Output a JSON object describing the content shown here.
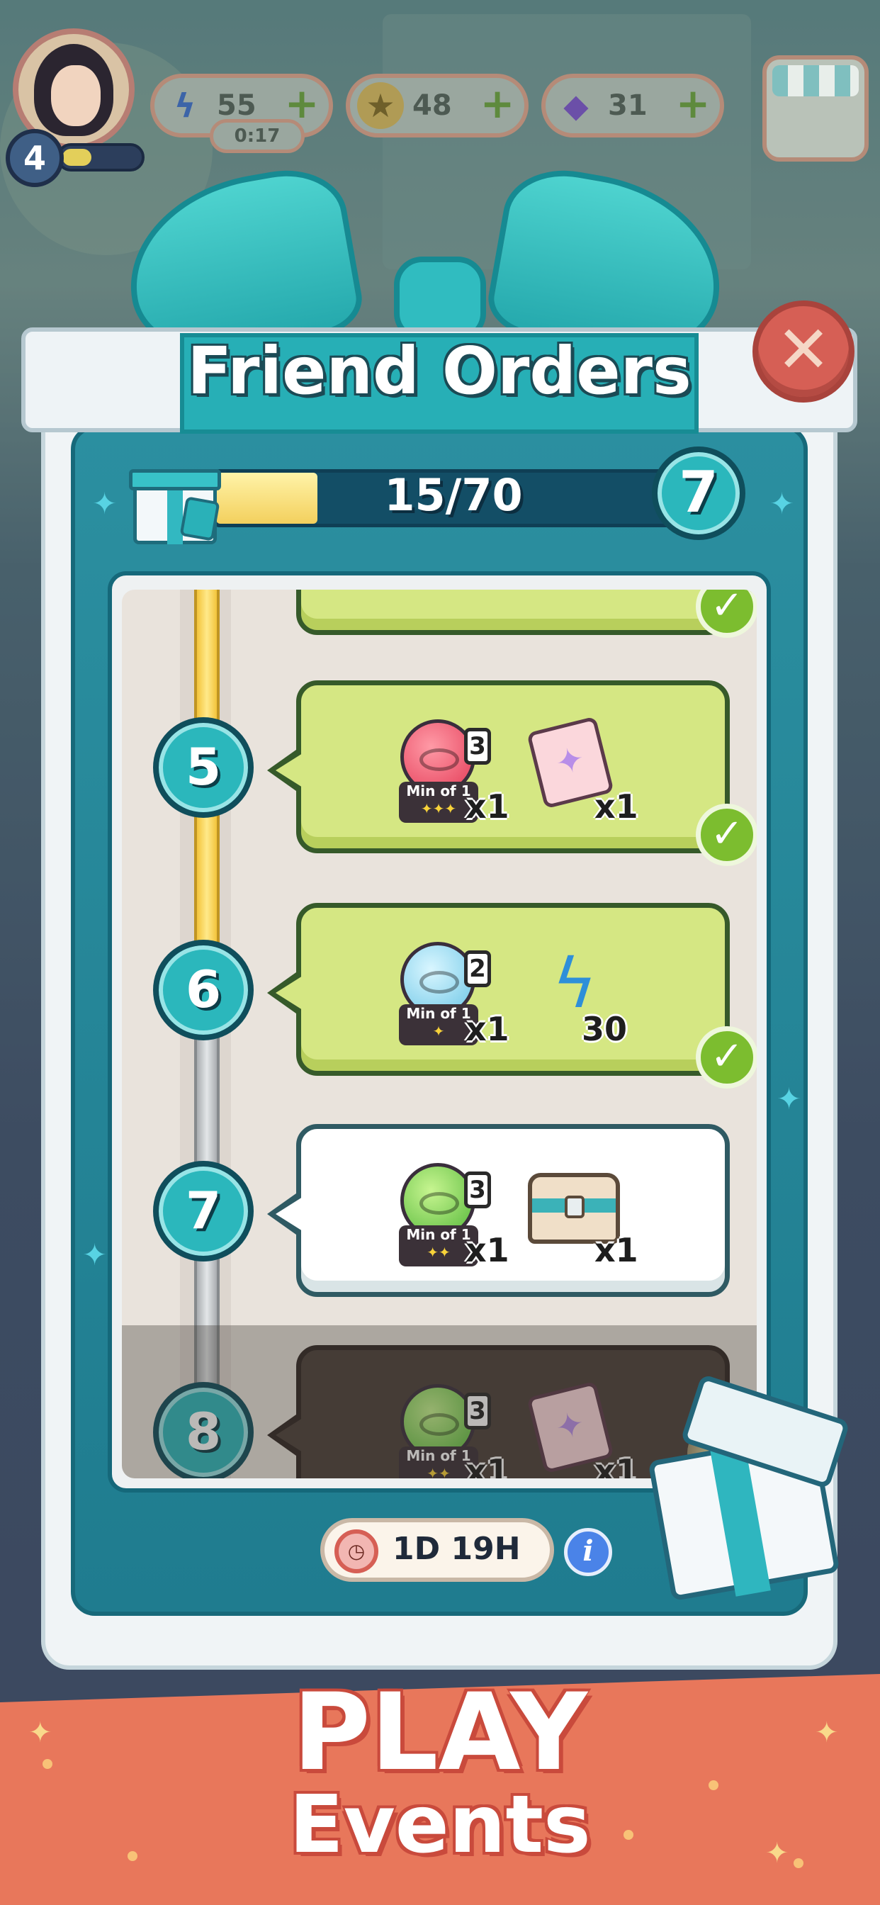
{
  "hud": {
    "level": "4",
    "xp_progress": 0.35,
    "energy": {
      "icon": "lightning-icon",
      "value": "55",
      "timer": "0:17"
    },
    "coins": {
      "icon": "coin-icon",
      "value": "48"
    },
    "gems": {
      "icon": "gem-icon",
      "value": "31"
    },
    "plus_symbol": "+"
  },
  "popup": {
    "title": "Friend Orders",
    "close_symbol": "✕",
    "progress": {
      "text": "15/70",
      "fraction": 0.214,
      "level": "7"
    },
    "orders": [
      {
        "step": "5",
        "state": "completed",
        "orb_color": "red",
        "orb_tier": "3",
        "min_label": "Min of 1",
        "stars": "✦✦✦",
        "orb_qty": "x1",
        "reward": "ticket-icon",
        "reward_qty": "x1"
      },
      {
        "step": "6",
        "state": "completed",
        "orb_color": "blue",
        "orb_tier": "2",
        "min_label": "Min of 1",
        "stars": "✦",
        "orb_qty": "x1",
        "reward": "energy-bolt-icon",
        "reward_qty": "30"
      },
      {
        "step": "7",
        "state": "active",
        "orb_color": "green",
        "orb_tier": "3",
        "min_label": "Min of 1",
        "stars": "✦✦",
        "orb_qty": "x1",
        "reward": "chest-icon",
        "reward_qty": "x1"
      },
      {
        "step": "8",
        "state": "locked",
        "orb_color": "green",
        "orb_tier": "3",
        "min_label": "Min of 1",
        "stars": "✦✦",
        "orb_qty": "x1",
        "reward": "ticket-icon",
        "reward_qty": "x1"
      }
    ],
    "timer": "1D 19H",
    "info_symbol": "i",
    "check_symbol": "✓"
  },
  "banner": {
    "title": "PLAY",
    "subtitle": "Events"
  },
  "colors": {
    "teal": "#2bb7bc",
    "completed_bubble": "#d5e783",
    "check_green": "#7cbd2f",
    "close_red": "#d65f55",
    "banner_orange": "#e8775b"
  }
}
